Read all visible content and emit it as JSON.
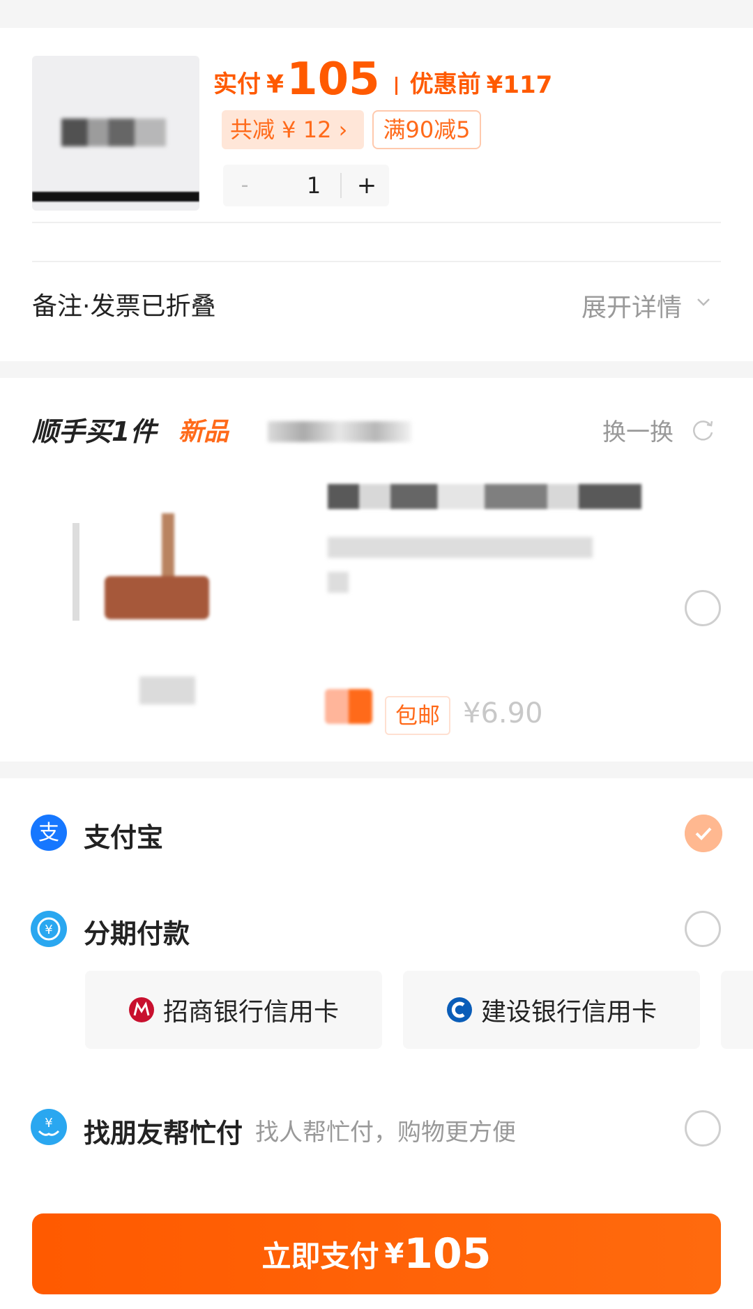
{
  "product": {
    "pay_label": "实付",
    "currency": "¥",
    "pay_amount": "105",
    "pre_label": "优惠前",
    "pre_amount": "¥117",
    "discount_tag": "共减 ¥ 12 ›",
    "full_reduction_tag": "满90减5",
    "quantity_minus": "-",
    "quantity": "1",
    "quantity_plus": "+"
  },
  "note": {
    "label": "备注·发票已折叠",
    "expand": "展开详情"
  },
  "buy_more": {
    "title": "顺手买1件",
    "new_tag": "新品",
    "swap_label": "换一换",
    "free_shipping": "包邮",
    "price": "¥6.90"
  },
  "payment": {
    "alipay_label": "支付宝",
    "installment_label": "分期付款",
    "banks": [
      "招商银行信用卡",
      "建设银行信用卡"
    ],
    "friend_label": "找朋友帮忙付",
    "friend_desc": "找人帮忙付，购物更方便"
  },
  "pay_button": {
    "label": "立即支付",
    "currency": "¥",
    "amount": "105"
  },
  "colors": {
    "accent": "#ff5a00",
    "alipay_blue": "#1677ff",
    "cmb_red": "#c8102e",
    "ccb_blue": "#0a5db8"
  },
  "icons": {
    "alipay": "alipay-icon",
    "installment": "installment-icon",
    "friend": "friend-pay-icon",
    "refresh": "refresh-icon",
    "chevron": "chevron-down-icon"
  }
}
